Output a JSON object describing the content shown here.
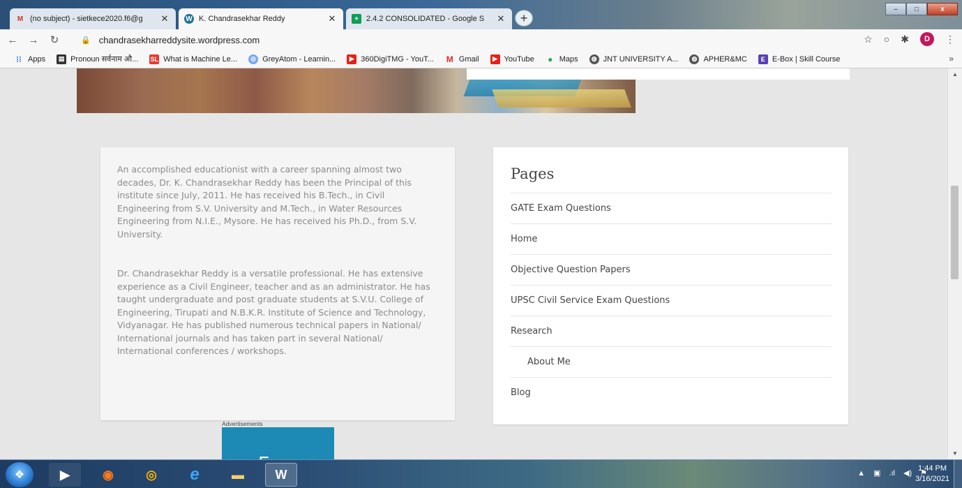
{
  "tabs": [
    {
      "title": "(no subject) - sietkece2020.f6@g",
      "icon": "gmail-icon",
      "active": false
    },
    {
      "title": "K. Chandrasekhar Reddy",
      "icon": "wordpress-icon",
      "active": true
    },
    {
      "title": "2.4.2 CONSOLIDATED - Google S",
      "icon": "google-sheets-icon",
      "active": false
    }
  ],
  "new_tab_label": "+",
  "window_controls": {
    "minimize": "–",
    "maximize": "□",
    "close": "x"
  },
  "address_bar": {
    "url": "chandrasekharreddysite.wordpress.com"
  },
  "profile_initial": "D",
  "bookmarks": [
    {
      "label": "Apps",
      "icon": "apps-grid-icon"
    },
    {
      "label": "Pronoun सर्वनाम औ...",
      "icon": "book-icon"
    },
    {
      "label": "What is Machine Le...",
      "icon": "sl-icon"
    },
    {
      "label": "GreyAtom - Learnin...",
      "icon": "greyatom-icon"
    },
    {
      "label": "360DigiTMG - YouT...",
      "icon": "youtube-icon"
    },
    {
      "label": "Gmail",
      "icon": "gmail-icon"
    },
    {
      "label": "YouTube",
      "icon": "youtube-icon"
    },
    {
      "label": "Maps",
      "icon": "maps-pin-icon"
    },
    {
      "label": "JNT UNIVERSITY A...",
      "icon": "globe-icon"
    },
    {
      "label": "APHER&MC",
      "icon": "globe-icon"
    },
    {
      "label": "E-Box | Skill Course",
      "icon": "ebox-icon"
    }
  ],
  "bookmarks_more": "»",
  "bio": {
    "paragraph1": "An accomplished educationist with a career spanning almost two decades, Dr. K. Chandrasekhar Reddy has been the Principal of this institute since July, 2011. He has received his B.Tech., in Civil Engineering from S.V. University and M.Tech., in Water Resources Engineering from N.I.E., Mysore. He has received his Ph.D., from S.V. University.",
    "paragraph2": "Dr. Chandrasekhar Reddy is a versatile professional. He has extensive experience as a Civil Engineer, teacher and as an administrator. He has taught undergraduate and post graduate students at S.V.U. College of Engineering, Tirupati and N.B.K.R. Institute of Science and Technology, Vidyanagar. He has published numerous technical papers in National/ International journals and has taken part in several National/ International conferences / workshops."
  },
  "pages_widget": {
    "title": "Pages",
    "links": [
      {
        "label": "GATE Exam Questions",
        "child": false
      },
      {
        "label": "Home",
        "child": false
      },
      {
        "label": "Objective Question Papers",
        "child": false
      },
      {
        "label": "UPSC Civil Service Exam Questions",
        "child": false
      },
      {
        "label": "Research",
        "child": false
      },
      {
        "label": "About Me",
        "child": true
      },
      {
        "label": "Blog",
        "child": false
      }
    ]
  },
  "advertisement": {
    "label": "Advertisements",
    "text": "Earn"
  },
  "taskbar": {
    "apps": [
      "media-player-icon",
      "firefox-icon",
      "chrome-icon",
      "internet-explorer-icon",
      "file-explorer-icon",
      "word-icon"
    ],
    "time": "1:44 PM",
    "date": "3/16/2021"
  },
  "colors": {
    "page_bg": "#e6e6e6",
    "link_text": "#454545",
    "body_text": "#8b8b8b",
    "ad_bg": "#1c8ab5"
  }
}
